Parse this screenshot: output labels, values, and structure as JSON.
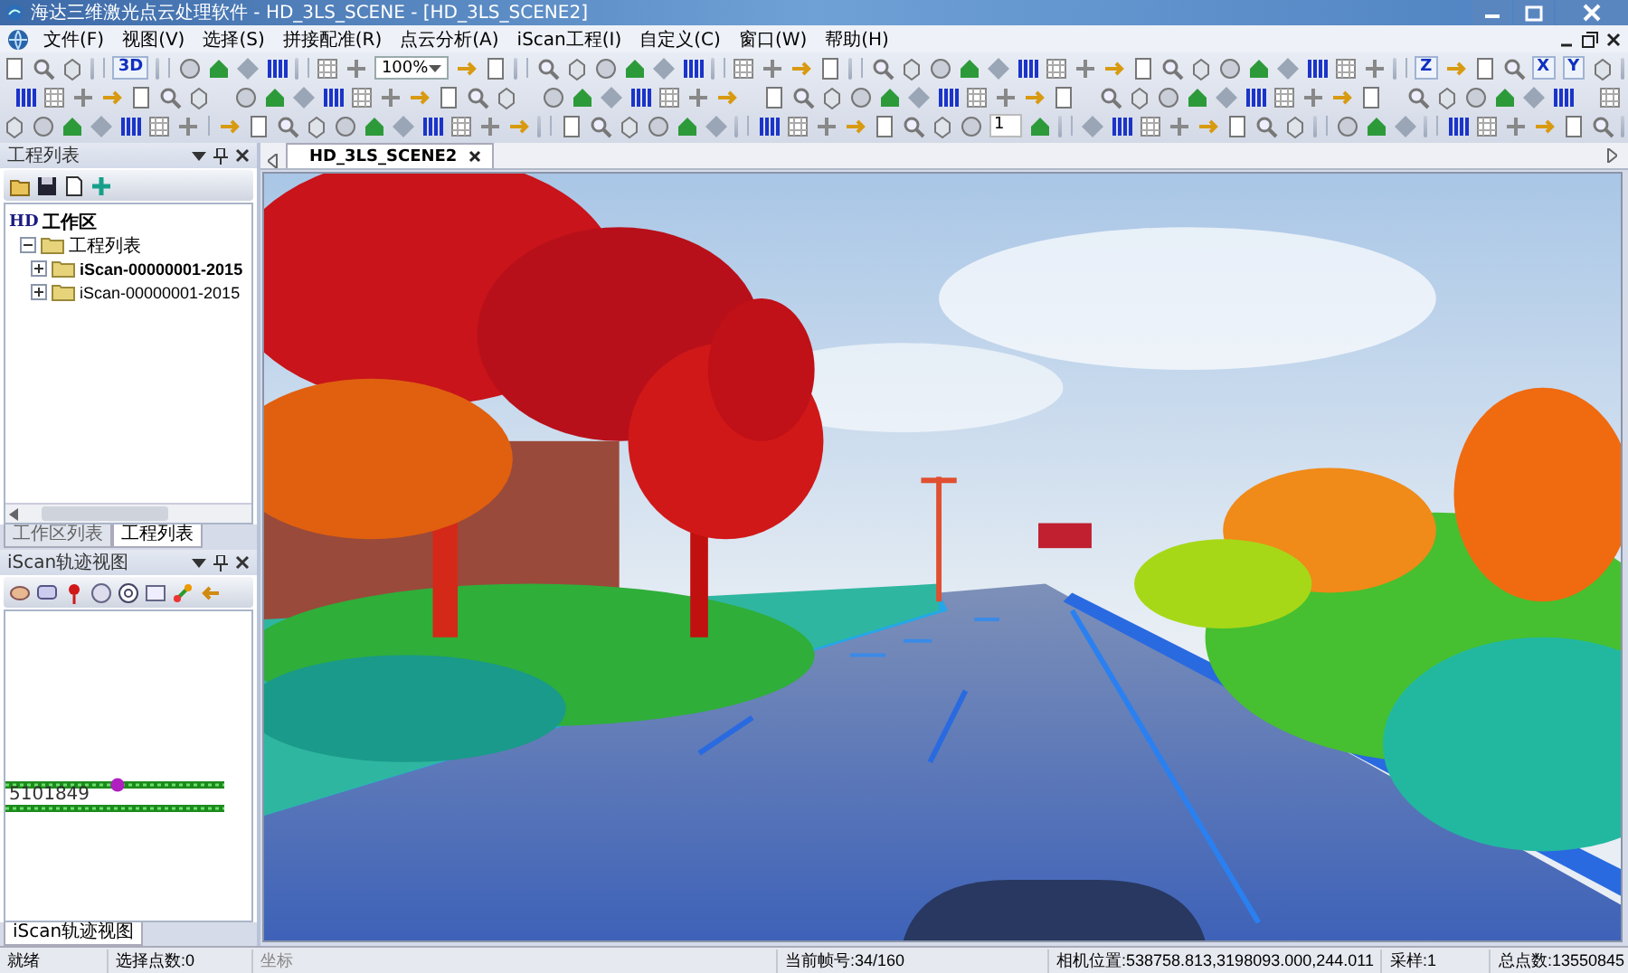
{
  "window": {
    "title": "海达三维激光点云处理软件 - HD_3LS_SCENE - [HD_3LS_SCENE2]"
  },
  "menu": [
    "文件(F)",
    "视图(V)",
    "选择(S)",
    "拼接配准(R)",
    "点云分析(A)",
    "iScan工程(I)",
    "自定义(C)",
    "窗口(W)",
    "帮助(H)"
  ],
  "toolbar": {
    "labels": [
      "3D",
      "Z",
      "X",
      "Y"
    ],
    "zoom_combo": "100%",
    "frame_field": "1"
  },
  "project_panel": {
    "title": "工程列表",
    "tree": {
      "badge": "HD",
      "label": "工作区",
      "children": [
        {
          "label": "工程列表",
          "expanded": true,
          "children": [
            {
              "label": "iScan-00000001-2015",
              "expanded": false,
              "active": true
            },
            {
              "label": "iScan-00000001-2015",
              "expanded": false,
              "active": false
            }
          ]
        }
      ]
    },
    "tabs": [
      {
        "label": "工作区列表",
        "selected": false
      },
      {
        "label": "工程列表",
        "selected": true
      }
    ]
  },
  "track_panel": {
    "title": "iScan轨迹视图",
    "point_label": "5101849",
    "tabs": [
      {
        "label": "iScan轨迹视图",
        "selected": true
      }
    ]
  },
  "document_tabs": [
    {
      "label": "HD_3LS_SCENE2",
      "selected": true
    }
  ],
  "status_bar": {
    "message": "就绪",
    "selected_points": "选择点数:0",
    "coordinates": "坐标",
    "frame": "当前帧号:34/160",
    "camera": "相机位置:538758.813,3198093.000,244.011",
    "sampling": "采样:1",
    "total_points": "总点数:13550845"
  }
}
